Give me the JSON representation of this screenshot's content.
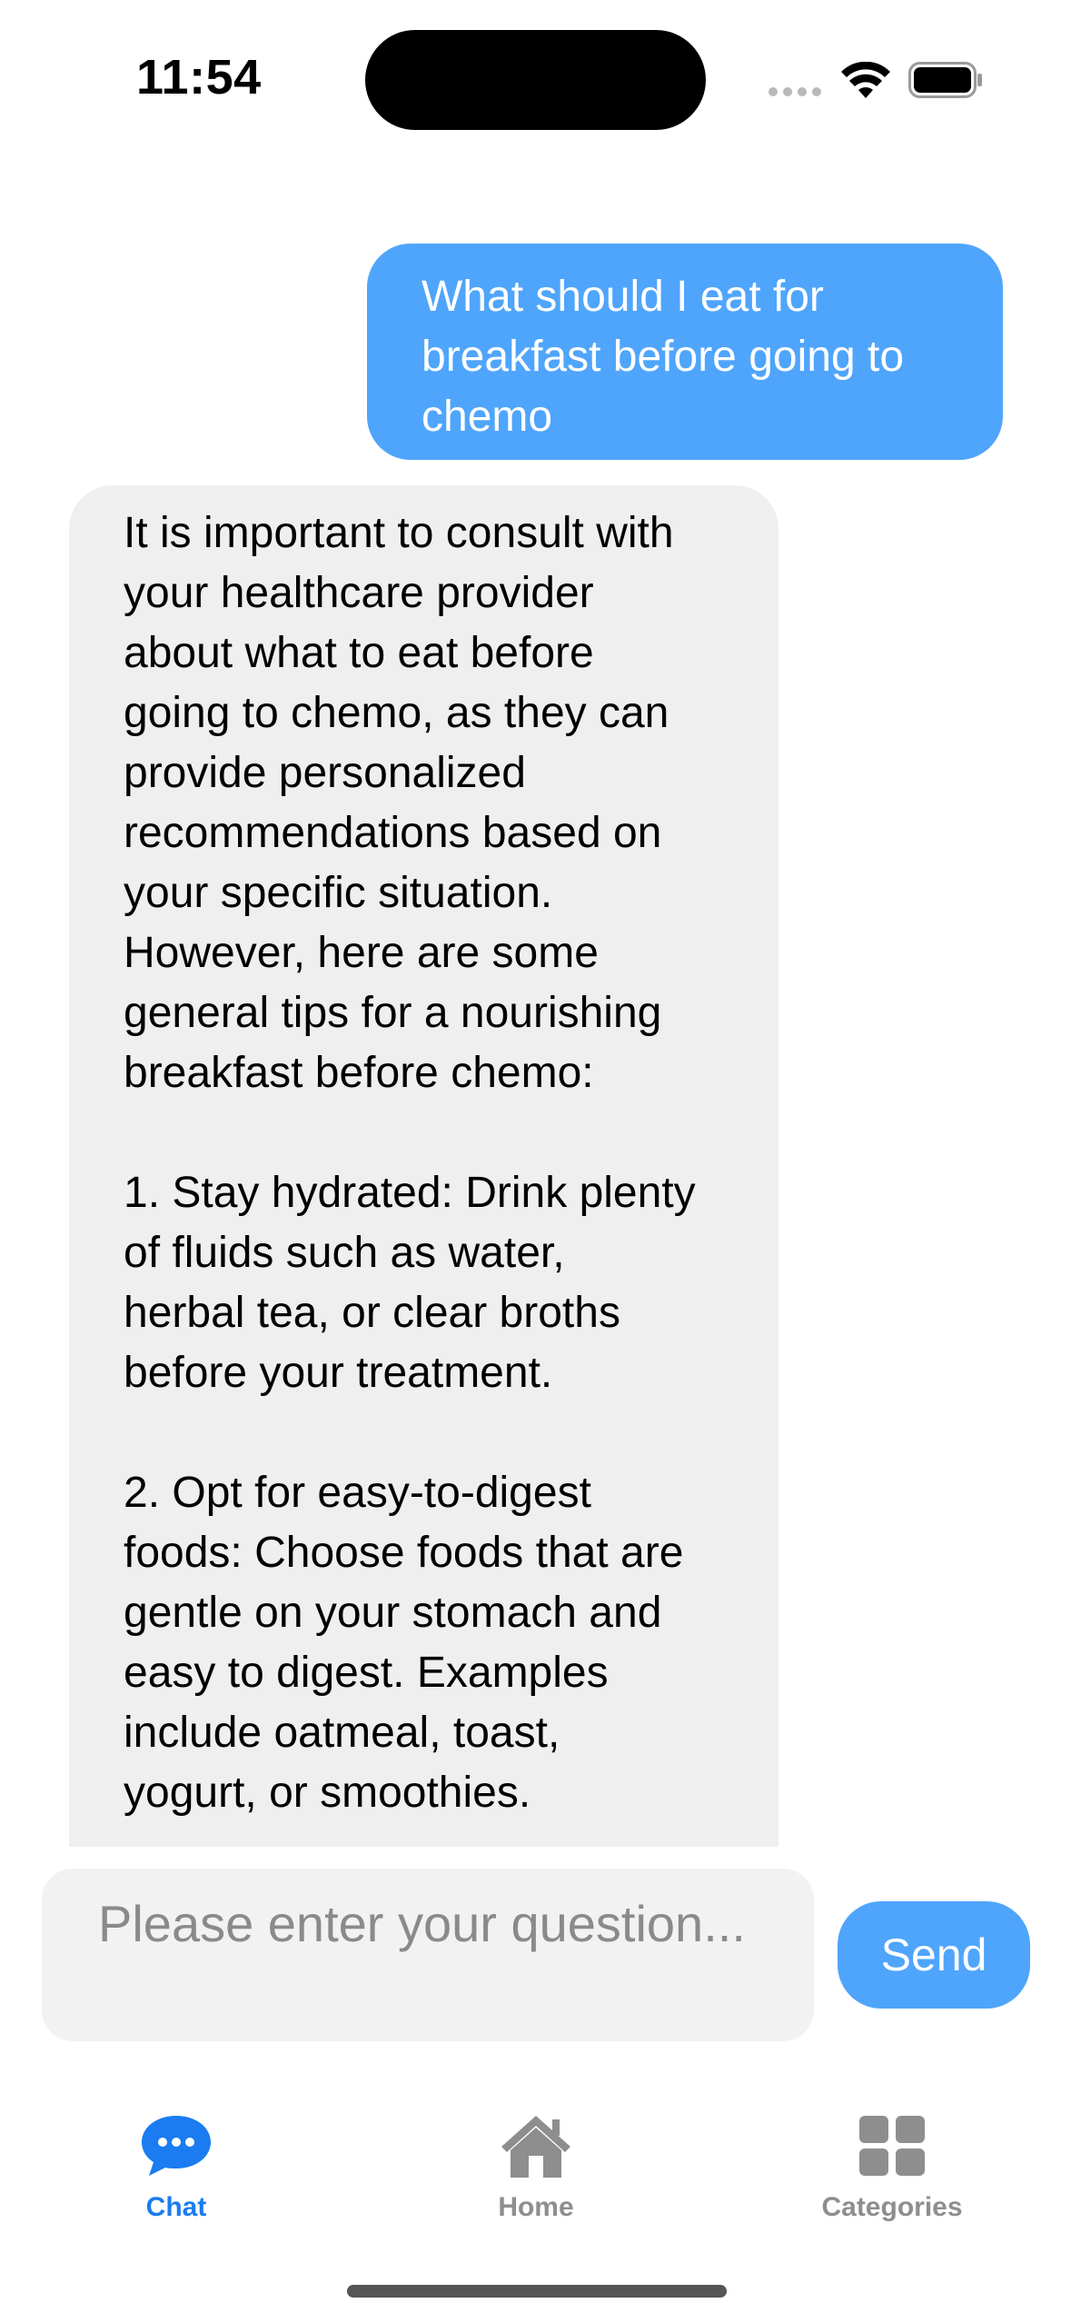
{
  "status_bar": {
    "time": "11:54"
  },
  "conversation": {
    "user_message": "What should I eat for\nbreakfast before going to\nchemo",
    "bot_message": "It is important to consult with\nyour healthcare provider\nabout what to eat before\ngoing to chemo, as they can\nprovide personalized\nrecommendations based on\nyour specific situation.\nHowever, here are some\ngeneral tips for a nourishing\nbreakfast before chemo:\n\n1. Stay hydrated: Drink plenty\nof fluids such as water,\nherbal tea, or clear broths\nbefore your treatment.\n\n2. Opt for easy-to-digest\nfoods: Choose foods that are\ngentle on your stomach and\neasy to digest. Examples\ninclude oatmeal, toast,\nyogurt, or smoothies."
  },
  "composer": {
    "placeholder": "Please enter your question...",
    "send_label": "Send"
  },
  "tabs": [
    {
      "label": "Chat",
      "icon": "chat-bubble-icon",
      "active": true
    },
    {
      "label": "Home",
      "icon": "house-icon",
      "active": false
    },
    {
      "label": "Categories",
      "icon": "grid-icon",
      "active": false
    }
  ],
  "colors": {
    "accent": "#1a7cf0",
    "user_bubble": "#4fa5fb",
    "bot_bubble": "#efefef",
    "inactive_tab": "#8e8e8e"
  }
}
